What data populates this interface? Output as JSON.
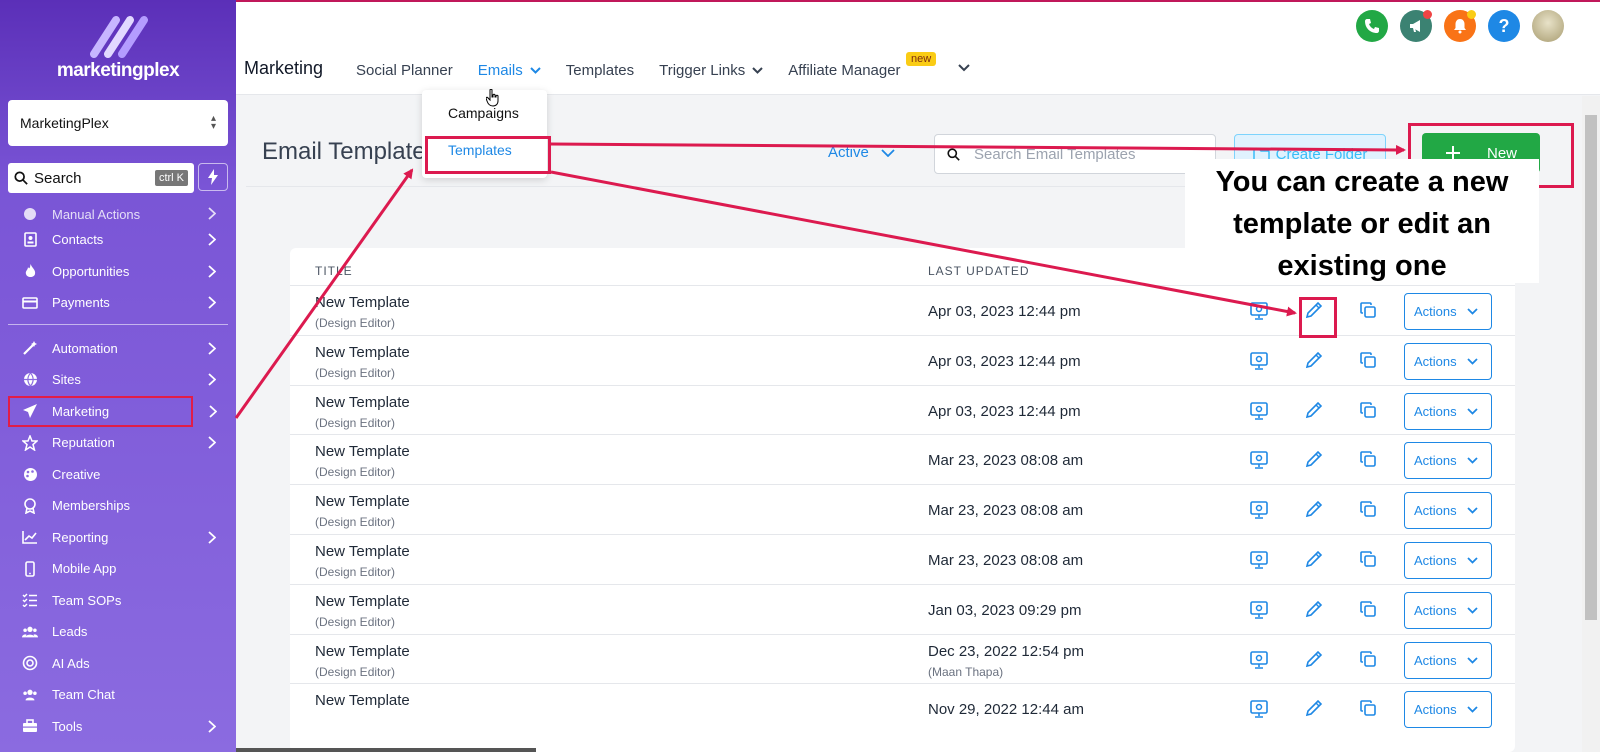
{
  "brand": {
    "name": "marketingplex"
  },
  "account": {
    "name": "MarketingPlex"
  },
  "sidebar_search": {
    "label": "Search",
    "shortcut": "ctrl K"
  },
  "sidebar": {
    "partial_item": "Manual Actions",
    "items_a": [
      {
        "label": "Contacts",
        "chevron": true
      },
      {
        "label": "Opportunities",
        "chevron": true
      },
      {
        "label": "Payments",
        "chevron": true
      }
    ],
    "items_b": [
      {
        "label": "Automation",
        "chevron": true
      },
      {
        "label": "Sites",
        "chevron": true
      },
      {
        "label": "Marketing",
        "chevron": true
      },
      {
        "label": "Reputation",
        "chevron": true
      },
      {
        "label": "Creative",
        "chevron": false
      },
      {
        "label": "Memberships",
        "chevron": false
      },
      {
        "label": "Reporting",
        "chevron": true
      },
      {
        "label": "Mobile App",
        "chevron": false
      },
      {
        "label": "Team SOPs",
        "chevron": false
      },
      {
        "label": "Leads",
        "chevron": false
      },
      {
        "label": "AI Ads",
        "chevron": false
      },
      {
        "label": "Team Chat",
        "chevron": false
      },
      {
        "label": "Tools",
        "chevron": true
      }
    ]
  },
  "header": {
    "section_title": "Marketing",
    "tabs": [
      "Social Planner",
      "Emails",
      "Templates",
      "Trigger Links",
      "Affiliate Manager"
    ],
    "new_badge": "new"
  },
  "emails_dropdown": {
    "items": [
      "Campaigns",
      "Templates"
    ]
  },
  "page": {
    "title": "Email Templates",
    "status_filter": "Active",
    "search_placeholder": "Search Email Templates",
    "create_folder_label": "Create Folder",
    "new_label": "New"
  },
  "table": {
    "columns": [
      "TITLE",
      "LAST UPDATED"
    ],
    "actions_label": "Actions",
    "rows": [
      {
        "title": "New Template",
        "editor": "(Design Editor)",
        "updated": "Apr 03, 2023 12:44 pm",
        "by": ""
      },
      {
        "title": "New Template",
        "editor": "(Design Editor)",
        "updated": "Apr 03, 2023 12:44 pm",
        "by": ""
      },
      {
        "title": "New Template",
        "editor": "(Design Editor)",
        "updated": "Apr 03, 2023 12:44 pm",
        "by": ""
      },
      {
        "title": "New Template",
        "editor": "(Design Editor)",
        "updated": "Mar 23, 2023 08:08 am",
        "by": ""
      },
      {
        "title": "New Template",
        "editor": "(Design Editor)",
        "updated": "Mar 23, 2023 08:08 am",
        "by": ""
      },
      {
        "title": "New Template",
        "editor": "(Design Editor)",
        "updated": "Mar 23, 2023 08:08 am",
        "by": ""
      },
      {
        "title": "New Template",
        "editor": "(Design Editor)",
        "updated": "Jan 03, 2023 09:29 pm",
        "by": ""
      },
      {
        "title": "New Template",
        "editor": "(Design Editor)",
        "updated": "Dec 23, 2022 12:54 pm",
        "by": "(Maan Thapa)"
      },
      {
        "title": "New Template",
        "editor": "",
        "updated": "Nov 29, 2022 12:44 am",
        "by": ""
      }
    ]
  },
  "annotation": {
    "lines": [
      "You can create a new",
      "template or edit an",
      "existing one"
    ]
  },
  "colors": {
    "accent": "#1e88e5",
    "new_button": "#22a845",
    "highlight": "#dc1a4f",
    "sidebar": "#7a55d6"
  }
}
